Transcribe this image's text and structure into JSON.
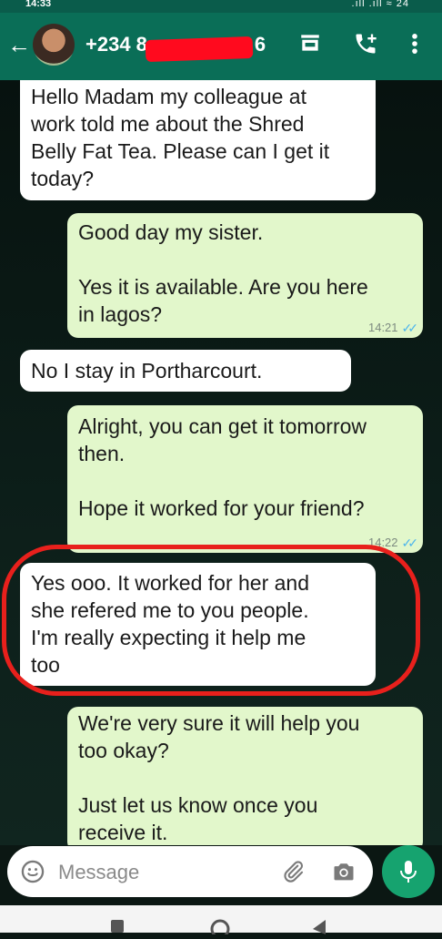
{
  "status_bar": {
    "time": "14:33",
    "indicators": ".ıll .ıll ≈ 24"
  },
  "header": {
    "contact": "+234 8",
    "contact_suffix": "6",
    "icons": [
      "back-arrow-icon",
      "store-icon",
      "add-call-icon",
      "more-vert-icon"
    ]
  },
  "messages": [
    {
      "direction": "incoming",
      "text": "Hello Madam my colleague at\nwork told me about the Shred\nBelly Fat Tea. Please can I get it\ntoday?"
    },
    {
      "direction": "outgoing",
      "text": "Good day my sister.\n\nYes it is available. Are you here\nin lagos?",
      "time": "14:21",
      "status": "read"
    },
    {
      "direction": "incoming",
      "text": "No I stay in Portharcourt."
    },
    {
      "direction": "outgoing",
      "text": "Alright, you can get it tomorrow\nthen.\n\nHope it worked for your friend?",
      "time": "14:22",
      "status": "read"
    },
    {
      "direction": "incoming",
      "text": "Yes ooo. It worked for her and\nshe refered me to you people.\nI'm really expecting it help me\ntoo"
    },
    {
      "direction": "outgoing",
      "text": "We're very sure it will help you\ntoo okay?\n\nJust let us know once you\nreceive it."
    }
  ],
  "composer": {
    "placeholder": "Message"
  },
  "colors": {
    "header": "#0a6e57",
    "outgoing_bubble": "#e2f7cb",
    "incoming_bubble": "#ffffff",
    "highlight": "#e8201c",
    "read_ticks": "#4fb6ec",
    "mic_button": "#16a36f"
  }
}
